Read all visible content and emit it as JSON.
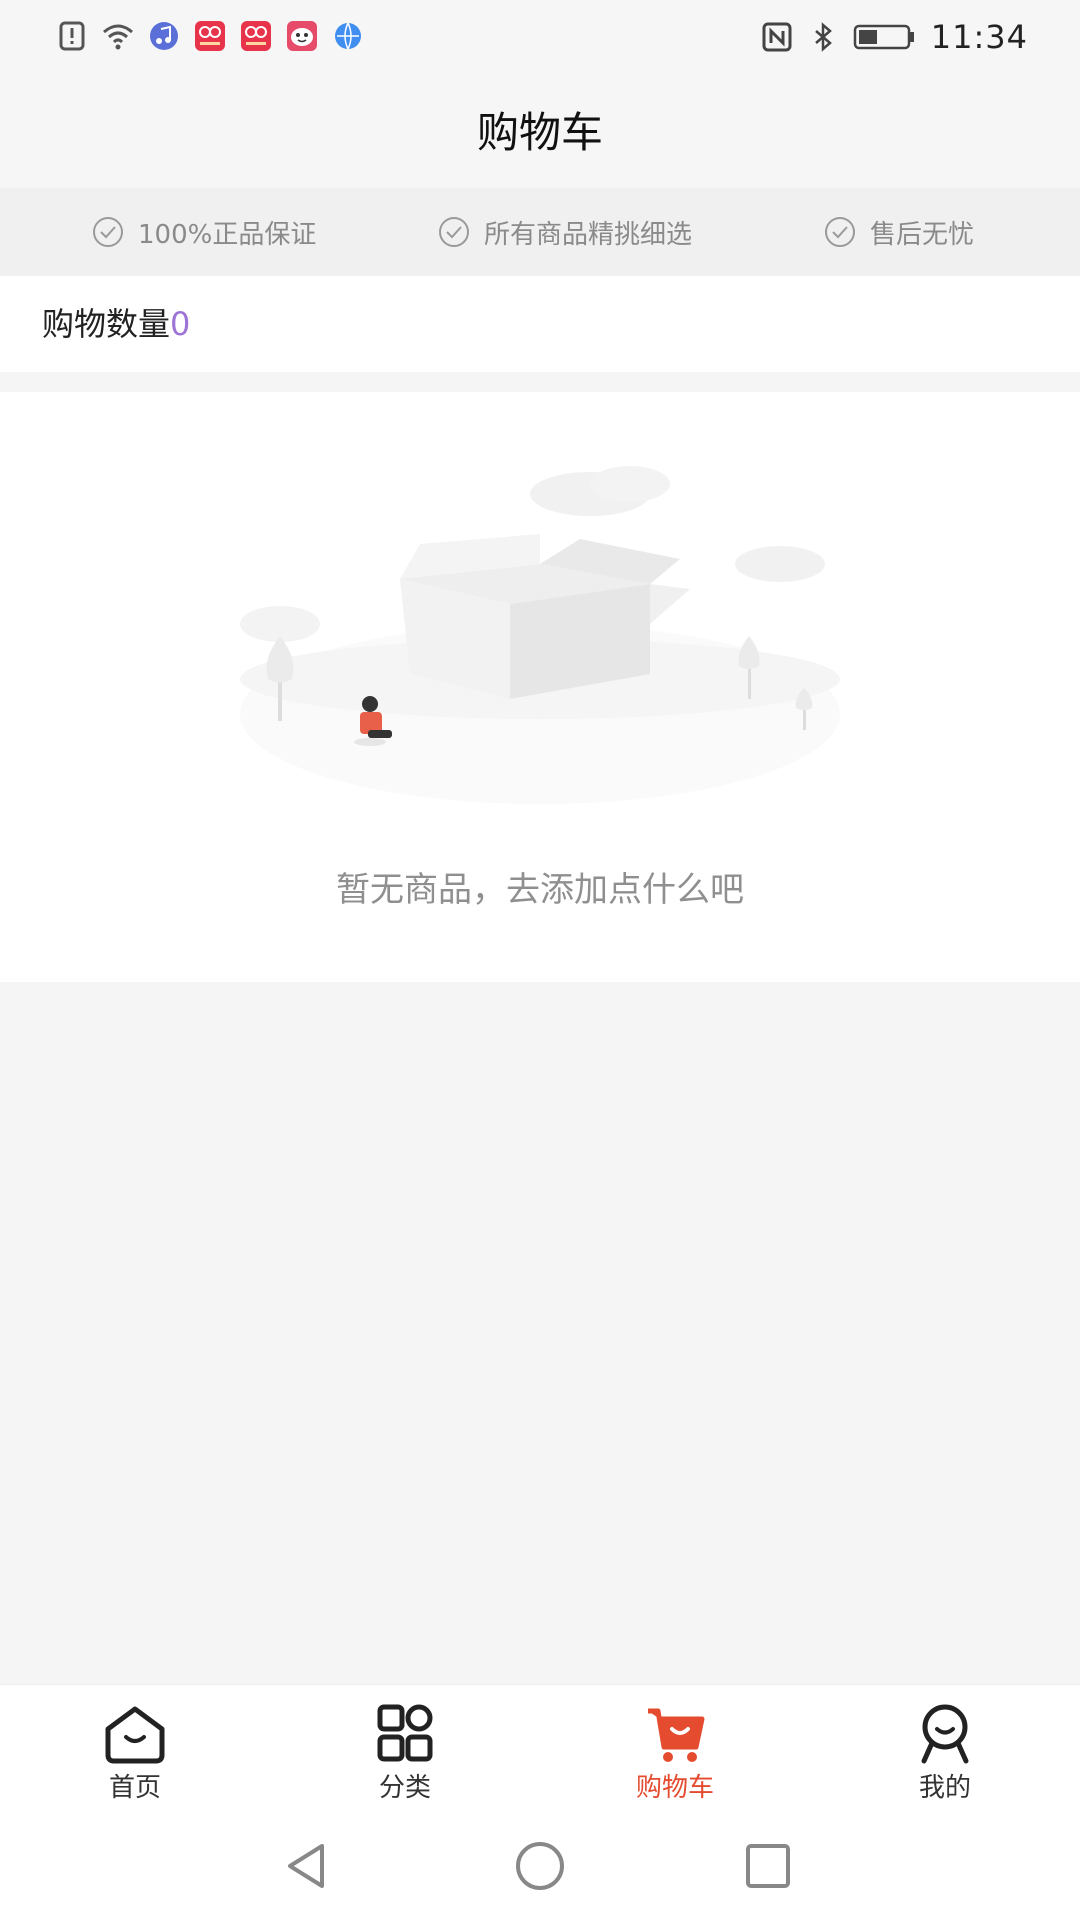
{
  "status_bar": {
    "time": "11:34",
    "left_icons": [
      "alert-icon",
      "wifi-icon",
      "music-app-icon",
      "shop-app-icon-1",
      "shop-app-icon-2",
      "face-app-icon",
      "browser-app-icon"
    ],
    "right_icons": [
      "nfc-icon",
      "bluetooth-icon",
      "battery-icon"
    ]
  },
  "header": {
    "title": "购物车"
  },
  "guarantees": [
    {
      "label": "100%正品保证"
    },
    {
      "label": "所有商品精挑细选"
    },
    {
      "label": "售后无忧"
    }
  ],
  "cart": {
    "count_label": "购物数量",
    "count_value": "0",
    "empty_text": "暂无商品，去添加点什么吧"
  },
  "tabs": [
    {
      "label": "首页",
      "icon": "home-icon",
      "active": false
    },
    {
      "label": "分类",
      "icon": "category-icon",
      "active": false
    },
    {
      "label": "购物车",
      "icon": "cart-icon",
      "active": true
    },
    {
      "label": "我的",
      "icon": "profile-icon",
      "active": false
    }
  ],
  "colors": {
    "accent": "#e44b2f",
    "count_color": "#9d73d6",
    "muted_text": "#8f8f8f"
  }
}
